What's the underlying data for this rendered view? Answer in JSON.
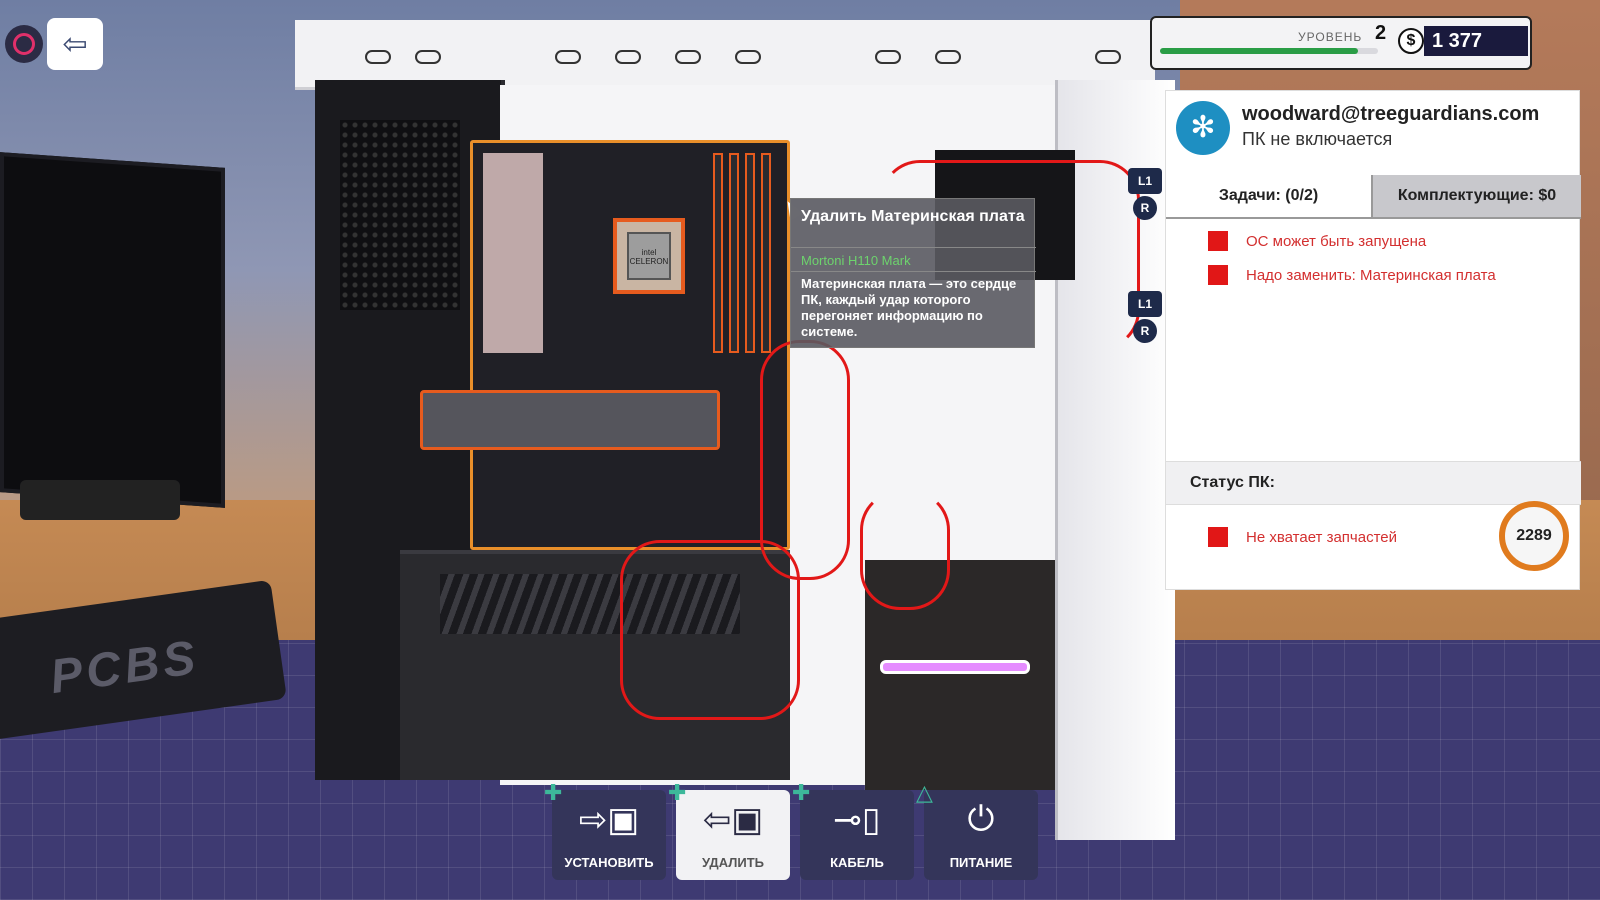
{
  "hud": {
    "pause_icon": "circle-icon",
    "exit_icon": "exit-icon",
    "level_label": "УРОВЕНЬ",
    "level_value": "2",
    "xp_progress": 0.91,
    "currency_symbol": "$",
    "money": "1 377"
  },
  "job": {
    "customer_email": "woodward@treeguardians.com",
    "problem": "ПК не включается",
    "tabs": {
      "tasks": "Задачи: (0/2)",
      "parts": "Комплектующие: $0"
    },
    "tasks": [
      {
        "label": "ОС может быть запущена",
        "status_color": "#e11717"
      },
      {
        "label": "Надо заменить: Материнская плата",
        "status_color": "#e11717"
      }
    ],
    "status_title": "Статус ПК:",
    "status_items": [
      {
        "label": "Не хватает запчастей",
        "status_color": "#e11717"
      }
    ],
    "status_value": "2289"
  },
  "tooltip": {
    "title": "Удалить Материнская плата",
    "subtitle": "Mortoni H110 Mark",
    "description": "Материнская плата — это сердце ПК, каждый удар которого перегоняет информацию по системе."
  },
  "controller_hints": {
    "l1": "L1",
    "r": "R"
  },
  "motherboard": {
    "cpu_label": "intel CELERON"
  },
  "toolbar": {
    "install": "УСТАНОВИТЬ",
    "remove": "УДАЛИТЬ",
    "cable": "КАБЕЛЬ",
    "power": "ПИТАНИЕ"
  },
  "scene": {
    "mousepad_logo": "PCBS"
  },
  "colors": {
    "accent_orange": "#e07b1e",
    "task_red": "#e11717",
    "money_bg": "#1a1a3d",
    "xp_green": "#2a9d46"
  }
}
